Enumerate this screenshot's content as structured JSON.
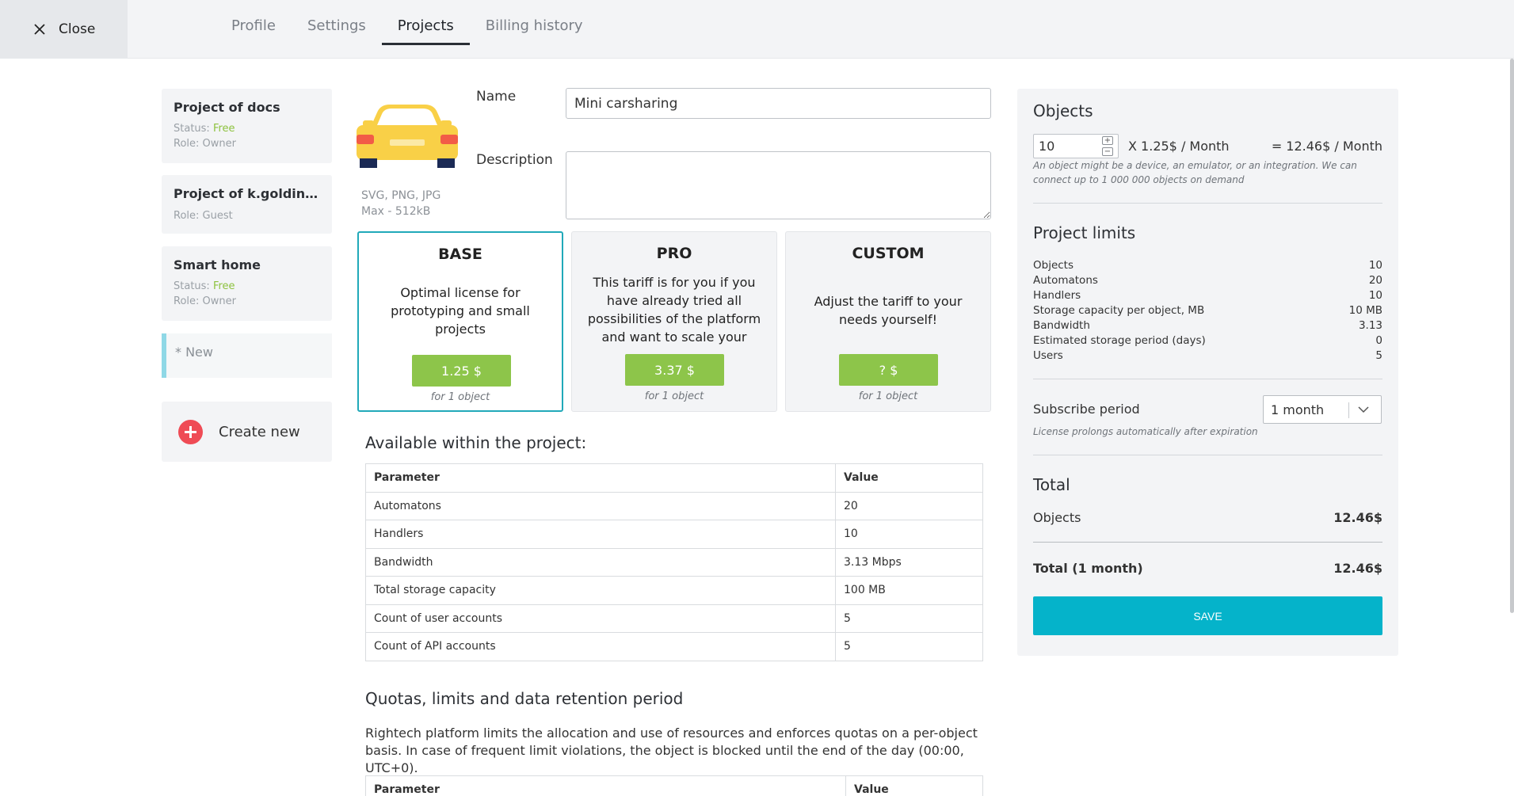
{
  "close_label": "Close",
  "tabs": [
    {
      "label": "Profile"
    },
    {
      "label": "Settings"
    },
    {
      "label": "Projects"
    },
    {
      "label": "Billing history"
    }
  ],
  "projects": [
    {
      "name": "Project of docs",
      "status_label": "Status:",
      "status": "Free",
      "role": "Role: Owner"
    },
    {
      "name": "Project of k.goldinova...",
      "role": "Role: Guest"
    },
    {
      "name": "Smart home",
      "status_label": "Status:",
      "status": "Free",
      "role": "Role: Owner"
    }
  ],
  "new_project_label": "* New",
  "create_new_label": "Create new",
  "form": {
    "name_label": "Name",
    "name_value": "Mini carsharing",
    "description_label": "Description",
    "description_value": "",
    "image_formats": "SVG, PNG, JPG",
    "image_max": "Max - 512kB"
  },
  "tariffs": [
    {
      "name": "BASE",
      "description": "Optimal license for prototyping and small projects",
      "price": "1.25 $",
      "unit": "for 1 object"
    },
    {
      "name": "PRO",
      "description": "This tariff is for you if you have already tried all possibilities of the platform and want to scale your",
      "price": "3.37 $",
      "unit": "for 1 object"
    },
    {
      "name": "CUSTOM",
      "description": "Adjust the tariff to your needs yourself!",
      "price": "? $",
      "unit": "for 1 object"
    }
  ],
  "available": {
    "title": "Available within the project:",
    "headers": [
      "Parameter",
      "Value"
    ],
    "rows": [
      [
        "Automatons",
        "20"
      ],
      [
        "Handlers",
        "10"
      ],
      [
        "Bandwidth",
        "3.13 Mbps"
      ],
      [
        "Total storage capacity",
        "100 MB"
      ],
      [
        "Count of user accounts",
        "5"
      ],
      [
        "Count of API accounts",
        "5"
      ]
    ]
  },
  "quotas": {
    "title": "Quotas, limits and data retention period",
    "text": "Rightech platform limits the allocation and use of resources and enforces quotas on a per-object basis. In case of frequent limit violations, the object is blocked until the end of the day (00:00, UTC+0).",
    "headers": [
      "Parameter",
      "Value"
    ]
  },
  "objects_panel": {
    "title": "Objects",
    "count": "10",
    "increment": "+",
    "decrement": "−",
    "multiplier": "X 1.25$ / Month",
    "result": "= 12.46$ / Month",
    "note": "An object might be a device, an emulator, or an integration. We can connect up to 1 000 000 objects on demand"
  },
  "limits_panel": {
    "title": "Project limits",
    "rows": [
      {
        "label": "Objects",
        "value": "10"
      },
      {
        "label": "Automatons",
        "value": "20"
      },
      {
        "label": "Handlers",
        "value": "10"
      },
      {
        "label": "Storage capacity per object, MB",
        "value": "10 MB"
      },
      {
        "label": "Bandwidth",
        "value": "3.13"
      },
      {
        "label": "Estimated storage period (days)",
        "value": "0"
      },
      {
        "label": "Users",
        "value": "5"
      }
    ]
  },
  "subscribe": {
    "label": "Subscribe period",
    "value": "1 month",
    "note": "License prolongs automatically after expiration"
  },
  "total": {
    "title": "Total",
    "objects_label": "Objects",
    "objects_value": "12.46$",
    "total_label": "Total (1 month)",
    "total_value": "12.46$"
  },
  "save_label": "SAVE",
  "colors": {
    "accent": "#05b3ca",
    "price_green": "#8dc54a",
    "free_green": "#8dc23e",
    "create_red": "#ef4b55",
    "car_yellow": "#f9d047"
  }
}
